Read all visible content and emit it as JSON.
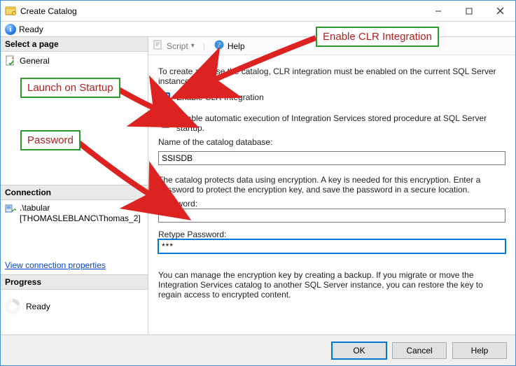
{
  "window": {
    "title": "Create Catalog"
  },
  "status": {
    "text": "Ready",
    "info_glyph": "i"
  },
  "sidebar": {
    "select_page_hdr": "Select a page",
    "pages": [
      {
        "label": "General"
      }
    ],
    "connection_hdr": "Connection",
    "connection_server": ".\\tabular",
    "connection_user": "[THOMASLEBLANC\\Thomas_2]",
    "view_conn_props": "View connection properties",
    "progress_hdr": "Progress",
    "progress_text": "Ready"
  },
  "toolbar": {
    "script_label": "Script",
    "help_label": "Help"
  },
  "main": {
    "intro": "To create and use the catalog, CLR integration must be enabled on the current SQL Server instance.",
    "enable_clr_label": "Enable CLR Integration",
    "enable_clr_checked": true,
    "auto_exec_label": "Enable automatic execution of Integration Services stored procedure at SQL Server startup.",
    "catalog_name_label": "Name of the catalog database:",
    "catalog_name_value": "SSISDB",
    "encryption_note": "The catalog protects data using encryption. A key is needed for this encryption. Enter a password to protect the encryption key, and save the password in a secure location.",
    "password_label": "Password:",
    "password_value": "****",
    "retype_label": "Retype Password:",
    "retype_value": "***",
    "manage_note": "You can manage the encryption key by creating a backup. If you migrate or move the Integration Services catalog to another SQL Server instance, you can restore the key to regain access to encrypted content."
  },
  "buttons": {
    "ok": "OK",
    "cancel": "Cancel",
    "help": "Help"
  },
  "annotations": {
    "enable_clr": "Enable CLR Integration",
    "launch_startup": "Launch on Startup",
    "password": "Password"
  }
}
